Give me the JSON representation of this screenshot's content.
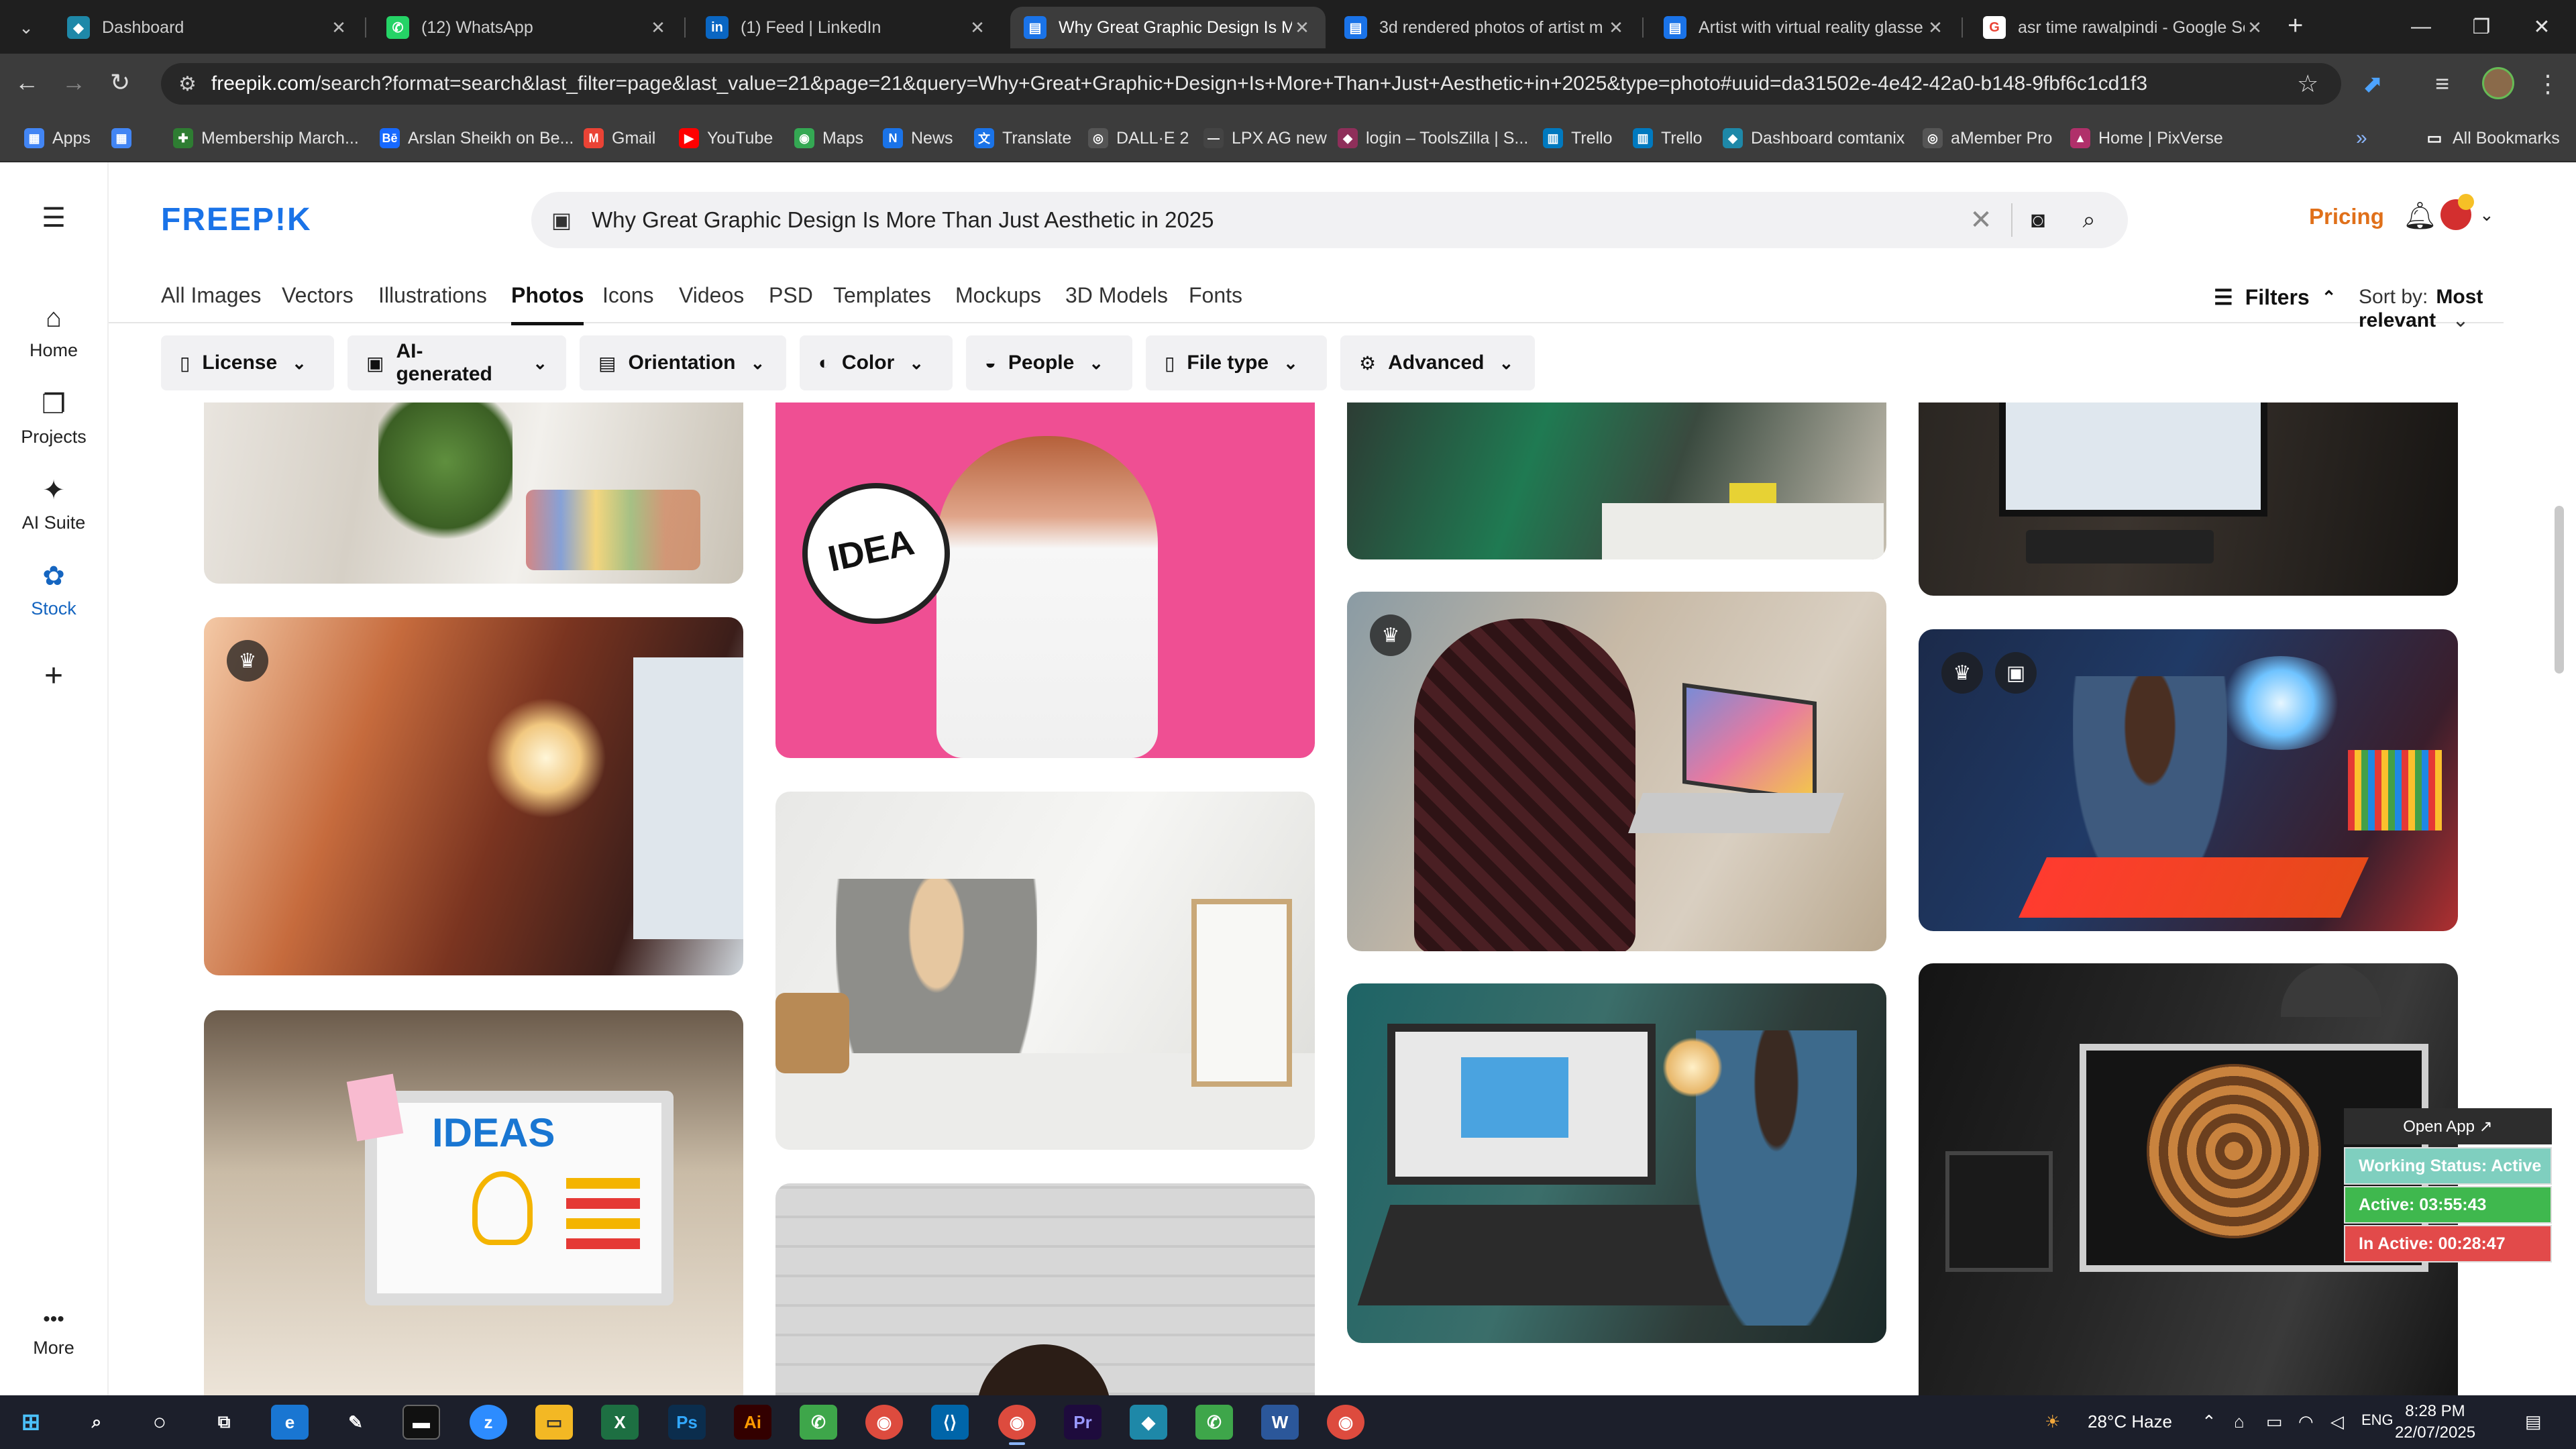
{
  "browser": {
    "tabs": [
      {
        "label": "Dashboard",
        "favicon": "◆",
        "color": "#1e88a8"
      },
      {
        "label": "(12) WhatsApp",
        "favicon": "✆",
        "color": "#25d366"
      },
      {
        "label": "(1) Feed | LinkedIn",
        "favicon": "in",
        "color": "#0a66c2"
      },
      {
        "label": "Why Great Graphic Design Is M",
        "favicon": "▤",
        "color": "#1a73e8"
      },
      {
        "label": "3d rendered photos of artist m",
        "favicon": "▤",
        "color": "#1a73e8"
      },
      {
        "label": "Artist with virtual reality glasse",
        "favicon": "▤",
        "color": "#1a73e8"
      },
      {
        "label": "asr time rawalpindi - Google Se",
        "favicon": "G",
        "color": "#ea4335"
      }
    ],
    "url_host": "freepik.com",
    "url_path": "/search?format=search&last_filter=page&last_value=21&page=21&query=Why+Great+Graphic+Design+Is+More+Than+Just+Aesthetic+in+2025&type=photo#uuid=da31502e-4e42-42a0-b148-9fbf6c1cd1f3",
    "bookmarks": [
      {
        "label": "Apps",
        "icon": "▦",
        "color": "#4285f4"
      },
      {
        "label": "",
        "icon": "▦",
        "color": "#4285f4"
      },
      {
        "label": "Membership March...",
        "icon": "✚",
        "color": "#2e7d32"
      },
      {
        "label": "Arslan Sheikh on Be...",
        "icon": "Bē",
        "color": "#1769ff"
      },
      {
        "label": "Gmail",
        "icon": "M",
        "color": "#ea4335"
      },
      {
        "label": "YouTube",
        "icon": "▶",
        "color": "#ff0000"
      },
      {
        "label": "Maps",
        "icon": "◉",
        "color": "#34a853"
      },
      {
        "label": "News",
        "icon": "N",
        "color": "#1a73e8"
      },
      {
        "label": "Translate",
        "icon": "文",
        "color": "#1a73e8"
      },
      {
        "label": "DALL·E 2",
        "icon": "◎",
        "color": "#555555"
      },
      {
        "label": "LPX AG new",
        "icon": "—",
        "color": "#444444"
      },
      {
        "label": "login – ToolsZilla | S...",
        "icon": "◆",
        "color": "#8e2f5a"
      },
      {
        "label": "Trello",
        "icon": "▥",
        "color": "#0079bf"
      },
      {
        "label": "Trello",
        "icon": "▥",
        "color": "#0079bf"
      },
      {
        "label": "Dashboard comtanix",
        "icon": "◆",
        "color": "#1e88a8"
      },
      {
        "label": "aMember Pro",
        "icon": "◎",
        "color": "#555555"
      },
      {
        "label": "Home | PixVerse",
        "icon": "▲",
        "color": "#b0306a"
      }
    ],
    "more_bookmarks": "»",
    "all_bookmarks": "All Bookmarks"
  },
  "sidebar": {
    "items": [
      {
        "label": "Home",
        "icon": "⌂"
      },
      {
        "label": "Projects",
        "icon": "❐"
      },
      {
        "label": "AI Suite",
        "icon": "✦"
      },
      {
        "label": "Stock",
        "icon": "✿"
      },
      {
        "label": "",
        "icon": "+"
      }
    ],
    "more_label": "More",
    "more_icon": "•••"
  },
  "header": {
    "logo": "FREEP!K",
    "search_query": "Why Great Graphic Design Is More Than Just Aesthetic in 2025",
    "pricing": "Pricing"
  },
  "type_tabs": [
    "All Images",
    "Vectors",
    "Illustrations",
    "Photos",
    "Icons",
    "Videos",
    "PSD",
    "Templates",
    "Mockups",
    "3D Models",
    "Fonts"
  ],
  "active_tab": "Photos",
  "filters_toggle": "Filters",
  "sort": {
    "label": "Sort by:",
    "value": "Most relevant"
  },
  "filter_chips": [
    {
      "label": "License",
      "icon": "▯"
    },
    {
      "label": "AI-generated",
      "icon": "▣"
    },
    {
      "label": "Orientation",
      "icon": "▤"
    },
    {
      "label": "Color",
      "icon": "◐"
    },
    {
      "label": "People",
      "icon": "◒"
    },
    {
      "label": "File type",
      "icon": "▯"
    },
    {
      "label": "Advanced",
      "icon": "⚙"
    }
  ],
  "image_text": {
    "idea_sign": "IDEA",
    "ideas_screen": "IDEAS"
  },
  "status_widget": {
    "open_app": "Open App ↗",
    "working": "Working Status: Active",
    "active": "Active: 03:55:43",
    "inactive": "In Active: 00:28:47"
  },
  "taskbar": {
    "weather": "28°C Haze",
    "language": "ENG",
    "time": "8:28 PM",
    "date": "22/07/2025"
  }
}
